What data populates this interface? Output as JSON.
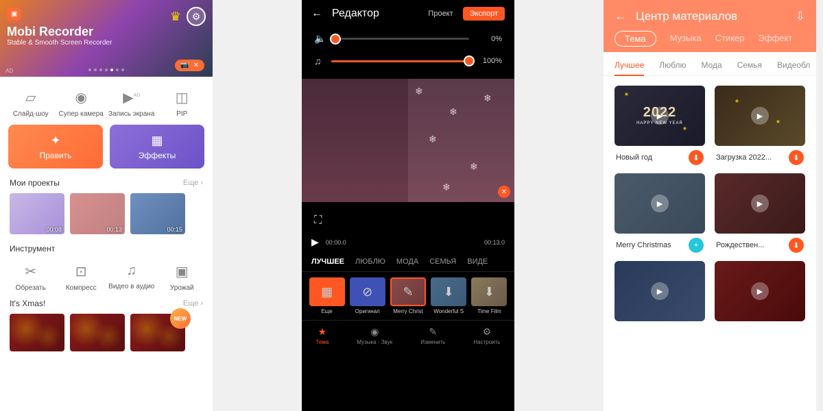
{
  "s1": {
    "banner": {
      "title": "Mobi Recorder",
      "sub": "Stable & Smooth Screen Recorder",
      "ad": "AD"
    },
    "tools": [
      {
        "label": "Слайд-шоу"
      },
      {
        "label": "Супер камера"
      },
      {
        "label": "Запись экрана",
        "ad": "AD"
      },
      {
        "label": "PIP"
      }
    ],
    "edit_btn": "Править",
    "fx_btn": "Эффекты",
    "projects": {
      "title": "Мои проекты",
      "more": "Еще",
      "items": [
        {
          "t": "00:08"
        },
        {
          "t": "00:13"
        },
        {
          "t": "00:15"
        }
      ]
    },
    "instrument": {
      "title": "Инструмент",
      "items": [
        {
          "label": "Обрезать"
        },
        {
          "label": "Компресс"
        },
        {
          "label": "Видео в аудио"
        },
        {
          "label": "Урожай"
        }
      ]
    },
    "xmas": {
      "title": "It's Xmas!",
      "more": "Еще",
      "new": "NEW"
    }
  },
  "s2": {
    "back": "←",
    "title": "Редактор",
    "project": "Проект",
    "export": "Экспорт",
    "vol_audio": "0%",
    "vol_music": "100%",
    "time_start": "00:00.0",
    "time_end": "00:13.0",
    "cats": [
      {
        "l": "ЛУЧШЕЕ",
        "a": true
      },
      {
        "l": "ЛЮБЛЮ"
      },
      {
        "l": "МОДА"
      },
      {
        "l": "СЕМЬЯ"
      },
      {
        "l": "ВИДЕ"
      }
    ],
    "themes": [
      {
        "l": "Еще"
      },
      {
        "l": "Оригинал"
      },
      {
        "l": "Merry Christ"
      },
      {
        "l": "Wonderful S"
      },
      {
        "l": "Time Film"
      }
    ],
    "nav": [
      {
        "l": "Тема",
        "a": true
      },
      {
        "l": "Музыка · Звук"
      },
      {
        "l": "Изменить"
      },
      {
        "l": "Настроить"
      }
    ]
  },
  "s3": {
    "title": "Центр материалов",
    "tabs": [
      {
        "l": "Тема",
        "a": true
      },
      {
        "l": "Музыка"
      },
      {
        "l": "Стикер"
      },
      {
        "l": "Эффект"
      }
    ],
    "subtabs": [
      {
        "l": "Лучшее",
        "a": true
      },
      {
        "l": "Люблю"
      },
      {
        "l": "Мода"
      },
      {
        "l": "Семья"
      },
      {
        "l": "Видеобл"
      }
    ],
    "cards": [
      {
        "title": "Новый год",
        "btn": "orange"
      },
      {
        "title": "Загрузка 2022...",
        "btn": "orange"
      },
      {
        "title": "Merry Christmas",
        "btn": "teal"
      },
      {
        "title": "Рождествен...",
        "btn": "orange"
      }
    ]
  }
}
